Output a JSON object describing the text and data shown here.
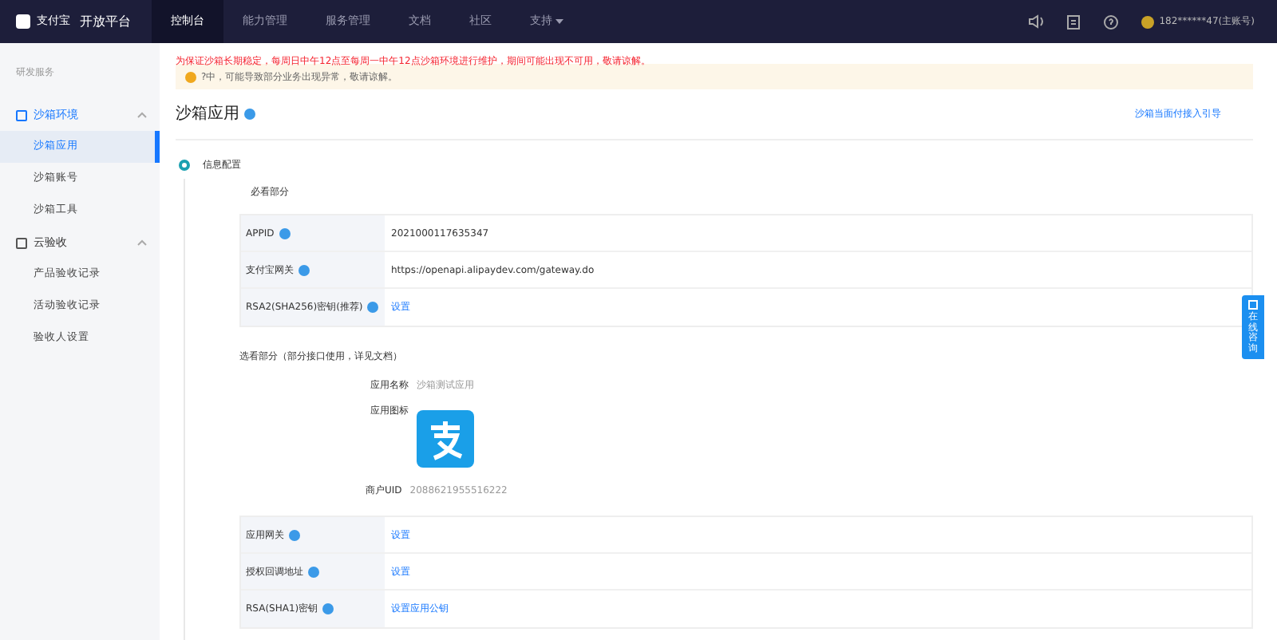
{
  "header": {
    "logo_brand": "支付宝",
    "logo_product": "开放平台",
    "nav": [
      {
        "label": "控制台",
        "selected": true
      },
      {
        "label": "能力管理",
        "selected": false
      },
      {
        "label": "服务管理",
        "selected": false
      },
      {
        "label": "文档",
        "selected": false
      },
      {
        "label": "社区",
        "selected": false
      },
      {
        "label": "支持",
        "selected": false,
        "dropdown": true
      }
    ],
    "account": "182******47(主账号)"
  },
  "sidebar": {
    "heading": "研发服务",
    "groups": [
      {
        "label": "沙箱环境",
        "expanded": true,
        "selected": true,
        "items": [
          {
            "label": "沙箱应用",
            "selected": true
          },
          {
            "label": "沙箱账号",
            "selected": false
          },
          {
            "label": "沙箱工具",
            "selected": false
          }
        ]
      },
      {
        "label": "云验收",
        "expanded": true,
        "selected": false,
        "items": [
          {
            "label": "产品验收记录",
            "selected": false
          },
          {
            "label": "活动验收记录",
            "selected": false
          },
          {
            "label": "验收人设置",
            "selected": false
          }
        ]
      }
    ]
  },
  "notices": [
    {
      "kind": "alert",
      "text": "为保证沙箱长期稳定，每周日中午12点至每周一中午12点沙箱环境进行维护，期间可能出现不可用，敬请谅解。"
    },
    {
      "kind": "warning",
      "text": "?中，可能导致部分业务出现异常，敬请谅解。"
    }
  ],
  "page": {
    "title": "沙箱应用",
    "guide_link": "沙箱当面付接入引导",
    "step": "信息配置",
    "required": {
      "heading": "必看部分",
      "rows": [
        {
          "label": "APPID",
          "value": "2021000117635347",
          "kind": "text"
        },
        {
          "label": "支付宝网关",
          "value": "https://openapi.alipaydev.com/gateway.do",
          "kind": "text"
        },
        {
          "label": "RSA2(SHA256)密钥(推荐)",
          "value": "设置",
          "kind": "link"
        }
      ]
    },
    "optional": {
      "heading": "选看部分（部分接口使用，详见文档）",
      "app_name_label": "应用名称",
      "app_name": "沙箱测试应用",
      "app_icon_label": "应用图标",
      "uid_label": "商户UID",
      "uid": "2088621955516222",
      "rows": [
        {
          "label": "应用网关",
          "value": "设置",
          "kind": "link"
        },
        {
          "label": "授权回调地址",
          "value": "设置",
          "kind": "link"
        },
        {
          "label": "RSA(SHA1)密钥",
          "value": "设置应用公钥",
          "kind": "link"
        }
      ]
    }
  },
  "float_tab": {
    "label": "在线咨询"
  }
}
